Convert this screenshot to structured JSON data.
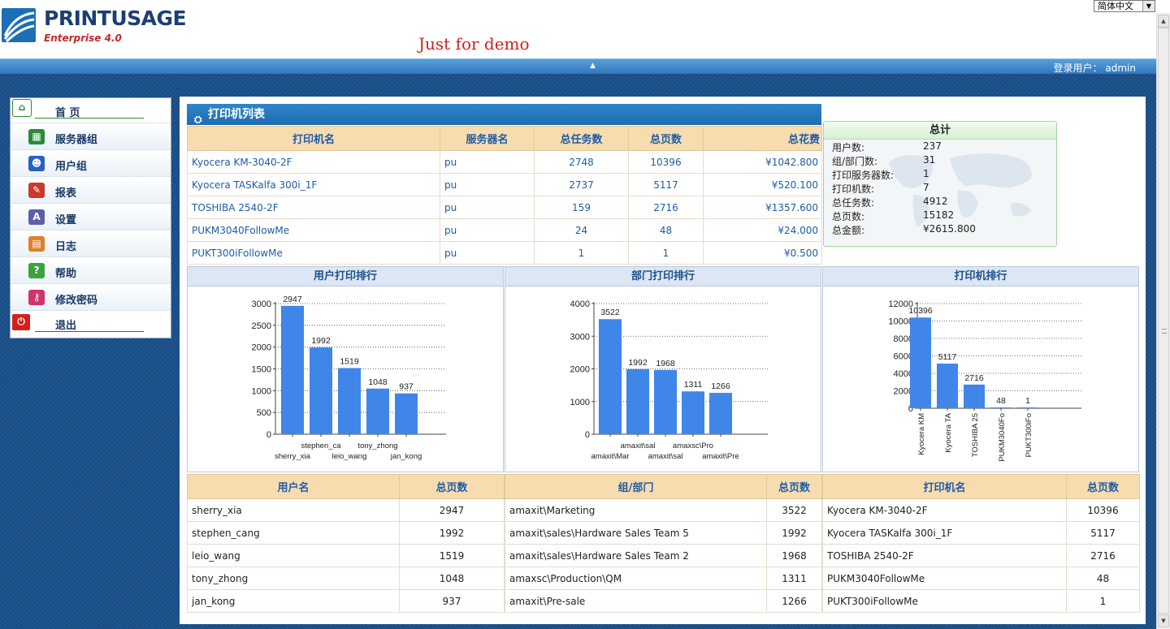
{
  "header": {
    "logo_brand_a": "PRINT",
    "logo_brand_b": "USAGE",
    "logo_subtitle": "Enterprise 4.0",
    "demo_notice": "Just for demo",
    "language": "简体中文",
    "login_label": "登录用户：",
    "login_user": "admin"
  },
  "sidebar": {
    "items": [
      {
        "label": "首 页",
        "icon": "home-icon"
      },
      {
        "label": "服务器组",
        "icon": "server-group-icon"
      },
      {
        "label": "用户组",
        "icon": "user-group-icon"
      },
      {
        "label": "报表",
        "icon": "report-icon"
      },
      {
        "label": "设置",
        "icon": "settings-icon"
      },
      {
        "label": "日志",
        "icon": "log-icon"
      },
      {
        "label": "帮助",
        "icon": "help-icon"
      },
      {
        "label": "修改密码",
        "icon": "key-icon"
      },
      {
        "label": "退出",
        "icon": "exit-icon"
      }
    ]
  },
  "printer_list": {
    "title": "打印机列表",
    "columns": [
      "打印机名",
      "服务器名",
      "总任务数",
      "总页数",
      "总花费"
    ],
    "rows": [
      [
        "Kyocera KM-3040-2F",
        "pu",
        "2748",
        "10396",
        "¥1042.800"
      ],
      [
        "Kyocera TASKalfa 300i_1F",
        "pu",
        "2737",
        "5117",
        "¥520.100"
      ],
      [
        "TOSHIBA 2540-2F",
        "pu",
        "159",
        "2716",
        "¥1357.600"
      ],
      [
        "PUKM3040FollowMe",
        "pu",
        "24",
        "48",
        "¥24.000"
      ],
      [
        "PUKT300iFollowMe",
        "pu",
        "1",
        "1",
        "¥0.500"
      ]
    ]
  },
  "totals": {
    "title": "总计",
    "rows": [
      {
        "label": "用户数:",
        "value": "237"
      },
      {
        "label": "组/部门数:",
        "value": "31"
      },
      {
        "label": "打印服务器数:",
        "value": "1"
      },
      {
        "label": "打印机数:",
        "value": "7"
      },
      {
        "label": "总任务数:",
        "value": "4912"
      },
      {
        "label": "总页数:",
        "value": "15182"
      },
      {
        "label": "总金额:",
        "value": "¥2615.800"
      }
    ]
  },
  "chart_data": [
    {
      "type": "bar",
      "title": "用户打印排行",
      "categories": [
        "sherry_xia",
        "stephen_ca",
        "leio_wang",
        "tony_zhong",
        "jan_kong"
      ],
      "values": [
        2947,
        1992,
        1519,
        1048,
        937
      ],
      "ylim": [
        0,
        3000
      ],
      "yticks": [
        0,
        500,
        1000,
        1500,
        2000,
        2500,
        3000
      ],
      "grid": true,
      "color": "#3f86e8"
    },
    {
      "type": "bar",
      "title": "部门打印排行",
      "categories": [
        "amaxit\\Mar",
        "amaxit\\sal",
        "amaxit\\sal",
        "amaxsc\\Pro",
        "amaxit\\Pre"
      ],
      "values": [
        3522,
        1992,
        1968,
        1311,
        1266
      ],
      "ylim": [
        0,
        4000
      ],
      "yticks": [
        0,
        1000,
        2000,
        3000,
        4000
      ],
      "grid": true,
      "color": "#3f86e8"
    },
    {
      "type": "bar",
      "title": "打印机排行",
      "categories": [
        "Kyocera KM",
        "Kyocera TA",
        "TOSHIBA 25",
        "PUKM3040Fo",
        "PUKT300iFo"
      ],
      "values": [
        10396,
        5117,
        2716,
        48,
        1
      ],
      "ylim": [
        0,
        12000
      ],
      "yticks": [
        0,
        2000,
        4000,
        6000,
        8000,
        10000,
        12000
      ],
      "grid": true,
      "color": "#3f86e8"
    }
  ],
  "rank_tables": [
    {
      "columns": [
        "用户名",
        "总页数"
      ],
      "rows": [
        [
          "sherry_xia",
          "2947"
        ],
        [
          "stephen_cang",
          "1992"
        ],
        [
          "leio_wang",
          "1519"
        ],
        [
          "tony_zhong",
          "1048"
        ],
        [
          "jan_kong",
          "937"
        ]
      ]
    },
    {
      "columns": [
        "组/部门",
        "总页数"
      ],
      "rows": [
        [
          "amaxit\\Marketing",
          "3522"
        ],
        [
          "amaxit\\sales\\Hardware Sales Team 5",
          "1992"
        ],
        [
          "amaxit\\sales\\Hardware Sales Team 2",
          "1968"
        ],
        [
          "amaxsc\\Production\\QM",
          "1311"
        ],
        [
          "amaxit\\Pre-sale",
          "1266"
        ]
      ]
    },
    {
      "columns": [
        "打印机名",
        "总页数"
      ],
      "rows": [
        [
          "Kyocera KM-3040-2F",
          "10396"
        ],
        [
          "Kyocera TASKalfa 300i_1F",
          "5117"
        ],
        [
          "TOSHIBA 2540-2F",
          "2716"
        ],
        [
          "PUKM3040FollowMe",
          "48"
        ],
        [
          "PUKT300iFollowMe",
          "1"
        ]
      ]
    }
  ]
}
